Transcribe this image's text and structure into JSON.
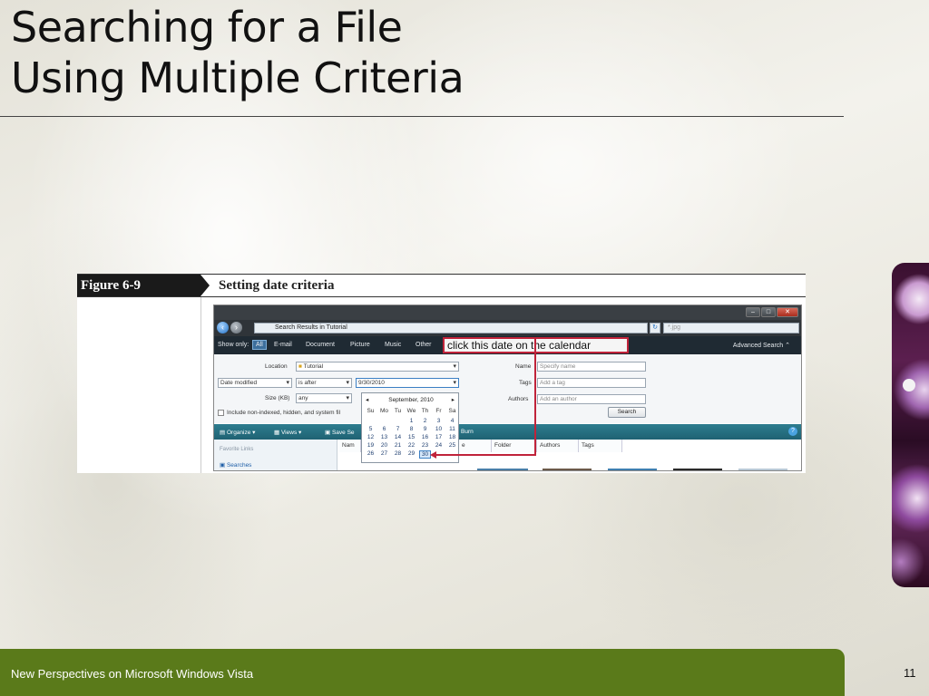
{
  "slide": {
    "title_line1": "Searching for a File",
    "title_line2": "Using Multiple Criteria",
    "footer_text": "New Perspectives on Microsoft Windows Vista",
    "page_number": "11",
    "footer_color": "#5a7a1a"
  },
  "figure": {
    "label": "Figure  6-9",
    "caption": "Setting date criteria"
  },
  "window": {
    "close_glyph": "✕",
    "address_text": "Search Results in Tutorial",
    "search_placeholder": "*.jpg",
    "show_only_label": "Show only:",
    "filters": [
      "All",
      "E-mail",
      "Document",
      "Picture",
      "Music",
      "Other"
    ],
    "callout": "click this date on the calendar",
    "advanced_search": "Advanced Search",
    "location_label": "Location",
    "location_value": "Tutorial",
    "date_field": "Date modified",
    "date_op": "is after",
    "date_value": "9/30/2010",
    "size_label": "Size (KB)",
    "size_value": "any",
    "include_label": "Include non-indexed, hidden, and system fil",
    "name_label": "Name",
    "name_placeholder": "Specify name",
    "tags_label": "Tags",
    "tags_placeholder": "Add a tag",
    "authors_label": "Authors",
    "authors_placeholder": "Add an author",
    "search_button": "Search",
    "toolbar": {
      "organize": "Organize",
      "views": "Views",
      "save_search": "Save Se",
      "burn": "Burn"
    },
    "favorite_links": "Favorite Links",
    "searches": "Searches",
    "columns": [
      "Nam",
      "e",
      "Folder",
      "Authors",
      "Tags"
    ],
    "accent": "#c0233a"
  },
  "calendar": {
    "month": "September, 2010",
    "prev": "◂",
    "next": "▸",
    "day_names": [
      "Su",
      "Mo",
      "Tu",
      "We",
      "Th",
      "Fr",
      "Sa"
    ],
    "weeks": [
      [
        "",
        "",
        "",
        "1",
        "2",
        "3",
        "4"
      ],
      [
        "5",
        "6",
        "7",
        "8",
        "9",
        "10",
        "11"
      ],
      [
        "12",
        "13",
        "14",
        "15",
        "16",
        "17",
        "18"
      ],
      [
        "19",
        "20",
        "21",
        "22",
        "23",
        "24",
        "25"
      ],
      [
        "26",
        "27",
        "28",
        "29",
        "30",
        "",
        ""
      ]
    ],
    "selected": "30"
  }
}
